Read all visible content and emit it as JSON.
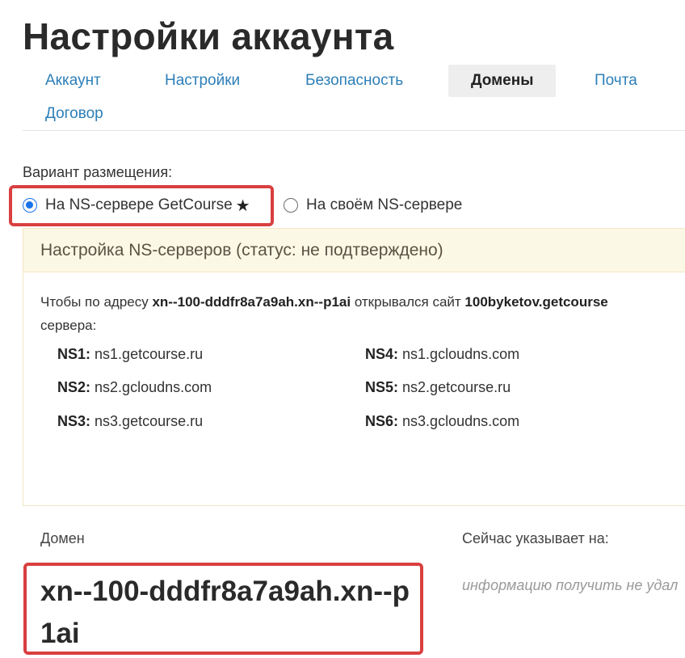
{
  "page": {
    "title": "Настройки аккаунта"
  },
  "tabs": [
    {
      "label": "Аккаунт",
      "active": false
    },
    {
      "label": "Настройки",
      "active": false
    },
    {
      "label": "Безопасность",
      "active": false
    },
    {
      "label": "Домены",
      "active": true
    },
    {
      "label": "Почта",
      "active": false
    },
    {
      "label": "Договор",
      "active": false
    }
  ],
  "placement": {
    "label": "Вариант размещения:",
    "options": [
      {
        "label": "На NS-сервере GetCourse",
        "selected": true,
        "badge": "★"
      },
      {
        "label": "На своём NS-сервере",
        "selected": false
      }
    ]
  },
  "ns_panel": {
    "title": "Настройка NS-серверов (статус: не подтверждено)",
    "desc_prefix": "Чтобы по адресу ",
    "desc_domain": "xn--100-dddfr8a7a9ah.xn--p1ai",
    "desc_middle": " открывался сайт ",
    "desc_site": "100byketov.getcourse",
    "desc_line2": "сервера:",
    "servers": [
      {
        "name": "NS1:",
        "value": "ns1.getcourse.ru"
      },
      {
        "name": "NS2:",
        "value": "ns2.gcloudns.com"
      },
      {
        "name": "NS3:",
        "value": "ns3.getcourse.ru"
      },
      {
        "name": "NS4:",
        "value": "ns1.gcloudns.com"
      },
      {
        "name": "NS5:",
        "value": "ns2.getcourse.ru"
      },
      {
        "name": "NS6:",
        "value": "ns3.gcloudns.com"
      }
    ]
  },
  "domain_section": {
    "domain_label": "Домен",
    "domain_value": "xn--100-dddfr8a7a9ah.xn--p1ai",
    "pointing_label": "Сейчас указывает на:",
    "pointing_value": "информацию получить не удал"
  },
  "colors": {
    "link": "#2d7fb8",
    "accent": "#d93f3f",
    "radio": "#1a73e8",
    "panel_header": "#fcf8e6"
  }
}
